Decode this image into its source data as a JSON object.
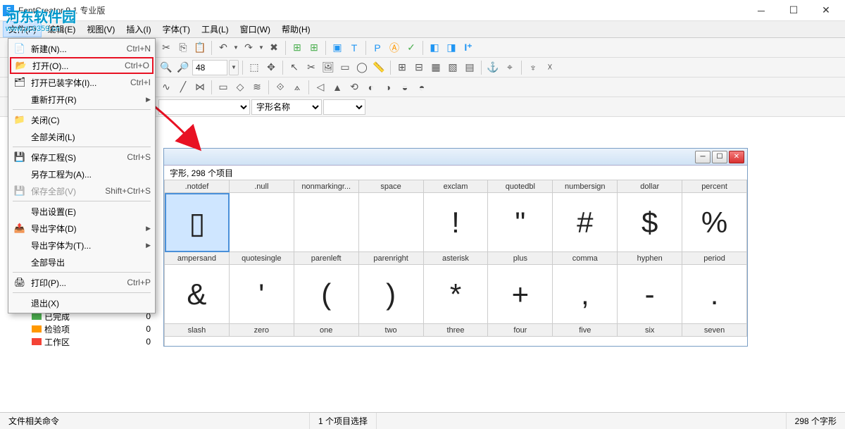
{
  "window": {
    "title": "FontCreator 9.1 专业版",
    "app_icon_letter": "F"
  },
  "watermark": {
    "main": "河东软件园",
    "url": "www.pc0359.cn"
  },
  "menubar": [
    "文件(F)",
    "编辑(E)",
    "视图(V)",
    "插入(I)",
    "字体(T)",
    "工具(L)",
    "窗口(W)",
    "帮助(H)"
  ],
  "file_menu": [
    {
      "icon": "new",
      "label": "新建(N)...",
      "shortcut": "Ctrl+N"
    },
    {
      "icon": "open",
      "label": "打开(O)...",
      "shortcut": "Ctrl+O",
      "highlighted": true
    },
    {
      "icon": "openfont",
      "label": "打开已装字体(I)...",
      "shortcut": "Ctrl+I"
    },
    {
      "icon": "",
      "label": "重新打开(R)",
      "arrow": true
    },
    {
      "sep": true
    },
    {
      "icon": "close",
      "label": "关闭(C)"
    },
    {
      "icon": "",
      "label": "全部关闭(L)"
    },
    {
      "sep": true
    },
    {
      "icon": "save",
      "label": "保存工程(S)",
      "shortcut": "Ctrl+S"
    },
    {
      "icon": "",
      "label": "另存工程为(A)..."
    },
    {
      "icon": "saveall",
      "label": "保存全部(V)",
      "shortcut": "Shift+Ctrl+S",
      "disabled": true
    },
    {
      "sep": true
    },
    {
      "icon": "",
      "label": "导出设置(E)"
    },
    {
      "icon": "export",
      "label": "导出字体(D)",
      "arrow": true
    },
    {
      "icon": "",
      "label": "导出字体为(T)...",
      "arrow": true
    },
    {
      "icon": "",
      "label": "全部导出"
    },
    {
      "sep": true
    },
    {
      "icon": "print",
      "label": "打印(P)...",
      "shortcut": "Ctrl+P"
    },
    {
      "sep": true
    },
    {
      "icon": "",
      "label": "退出(X)"
    }
  ],
  "toolbar3_label": "字形名称",
  "zoom_value": "48",
  "tree_items": [
    {
      "label": "已完成",
      "count": "0",
      "color": "#4caf50"
    },
    {
      "label": "检验项",
      "count": "0",
      "color": "#ff9800"
    },
    {
      "label": "工作区",
      "count": "0",
      "color": "#f44336"
    }
  ],
  "mdi": {
    "caption": "",
    "subtitle": "字形, 298 个项目",
    "row1_heads": [
      ".notdef",
      ".null",
      "nonmarkingr...",
      "space",
      "exclam",
      "quotedbl",
      "numbersign",
      "dollar",
      "percent"
    ],
    "row1_glyphs": [
      "▯",
      "",
      "",
      "",
      "!",
      "\"",
      "#",
      "$",
      "%"
    ],
    "row2_heads": [
      "ampersand",
      "quotesingle",
      "parenleft",
      "parenright",
      "asterisk",
      "plus",
      "comma",
      "hyphen",
      "period"
    ],
    "row2_glyphs": [
      "&",
      "'",
      "(",
      ")",
      "*",
      "+",
      ",",
      "-",
      "."
    ],
    "row3_heads": [
      "slash",
      "zero",
      "one",
      "two",
      "three",
      "four",
      "five",
      "six",
      "seven"
    ]
  },
  "statusbar": {
    "left": "文件相关命令",
    "mid": "1 个项目选择",
    "right": "298 个字形"
  }
}
